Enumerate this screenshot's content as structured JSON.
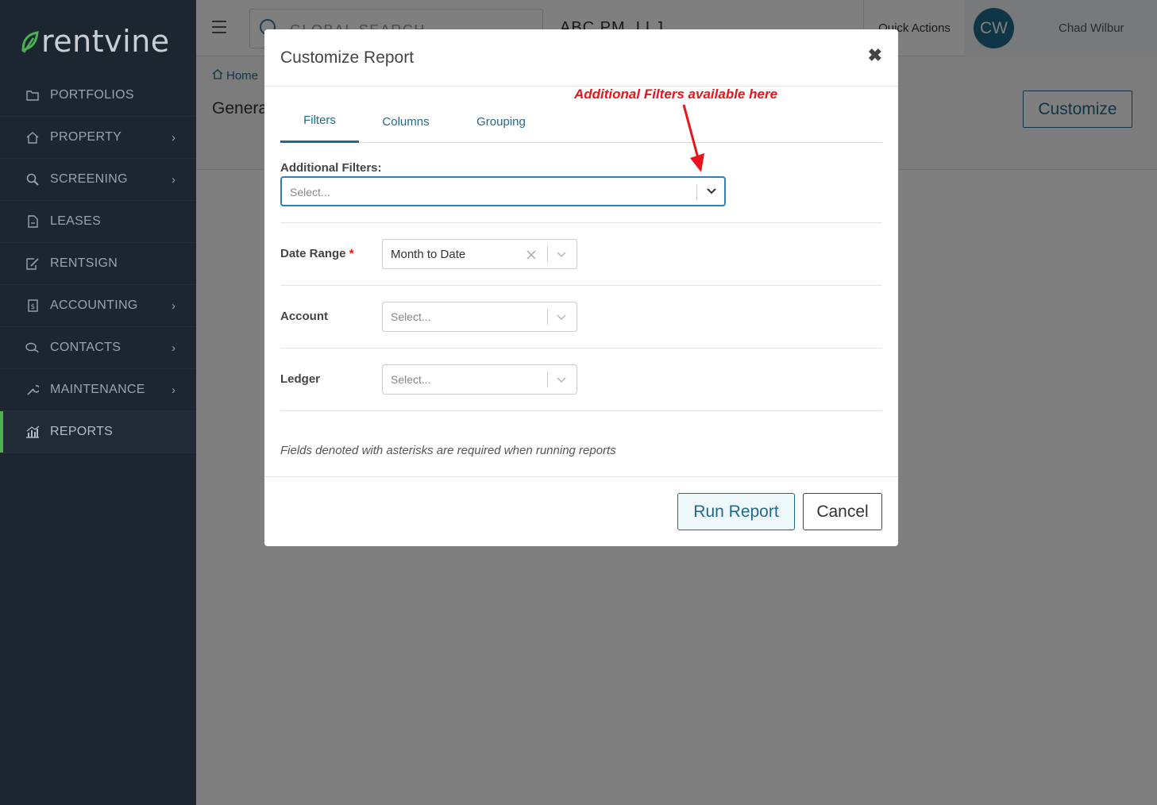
{
  "brand": {
    "name": "rentvine",
    "accent": "#4caf50"
  },
  "sidebar": {
    "items": [
      {
        "label": "PORTFOLIOS",
        "icon": "folder-icon",
        "chevron": false
      },
      {
        "label": "PROPERTY",
        "icon": "home-icon",
        "chevron": true
      },
      {
        "label": "SCREENING",
        "icon": "magnify-icon",
        "chevron": true
      },
      {
        "label": "LEASES",
        "icon": "document-icon",
        "chevron": false
      },
      {
        "label": "RENTSIGN",
        "icon": "sign-icon",
        "chevron": false
      },
      {
        "label": "ACCOUNTING",
        "icon": "dollar-icon",
        "chevron": true
      },
      {
        "label": "CONTACTS",
        "icon": "chat-icon",
        "chevron": true
      },
      {
        "label": "MAINTENANCE",
        "icon": "wrench-icon",
        "chevron": true
      },
      {
        "label": "REPORTS",
        "icon": "chart-icon",
        "chevron": false,
        "active": true
      }
    ],
    "chevron_glyph": "›"
  },
  "topbar": {
    "search_placeholder": "GLOBAL SEARCH",
    "company": "ABC PM, LLJ",
    "quick_actions": "Quick Actions",
    "avatar_initials": "CW",
    "user_name": "Chad Wilbur"
  },
  "page": {
    "breadcrumb_home": "Home",
    "title": "Genera",
    "customize_label": "Customize"
  },
  "modal": {
    "title": "Customize Report",
    "close_glyph": "✖",
    "tabs": [
      "Filters",
      "Columns",
      "Grouping"
    ],
    "active_tab": "Filters",
    "annotation": "Additional Filters available here",
    "additional_filters_label": "Additional Filters:",
    "additional_filters_placeholder": "Select...",
    "fields": [
      {
        "label": "Date Range",
        "required": "*",
        "value": "Month to Date",
        "clearable": true
      },
      {
        "label": "Account",
        "placeholder": "Select..."
      },
      {
        "label": "Ledger",
        "placeholder": "Select..."
      }
    ],
    "note": "Fields denoted with asterisks are required when running reports",
    "run_label": "Run Report",
    "cancel_label": "Cancel"
  }
}
